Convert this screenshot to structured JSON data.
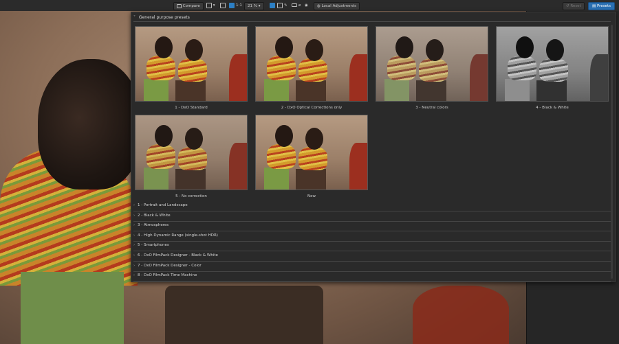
{
  "toolbar": {
    "compare_label": "Compare",
    "zoom_ratio": "1:1",
    "zoom_level": "21 %",
    "local_adjustments_label": "Local Adjustments",
    "reset_label": "Reset",
    "presets_label": "Presets"
  },
  "panel": {
    "header": "General purpose presets",
    "presets": [
      {
        "label": "1 - DxO Standard",
        "style": "normal"
      },
      {
        "label": "2 - DxO Optical Corrections only",
        "style": "normal"
      },
      {
        "label": "3 - Neutral colors",
        "style": "muted"
      },
      {
        "label": "4 - Black & White",
        "style": "bw"
      },
      {
        "label": "5 - No correction",
        "style": "flat"
      },
      {
        "label": "New",
        "style": "normal"
      }
    ],
    "categories": [
      "1 - Portrait and Landscape",
      "2 - Black & White",
      "3 - Atmospheres",
      "4 - High Dynamic Range (single-shot HDR)",
      "5 - Smartphones",
      "6 - DxO FilmPack Designer - Black & White",
      "7 - DxO FilmPack Designer - Color",
      "8 - DxO FilmPack Time Machine"
    ]
  },
  "colors": {
    "accent": "#2a6fb2",
    "panel_bg": "#2a2a2a"
  },
  "icons": [
    "compare-icon",
    "crop-icon",
    "move-icon",
    "eyedropper-icon",
    "repair-icon",
    "mask-icon",
    "eye-icon",
    "local-adjustments-icon",
    "chevron-down-icon",
    "chevron-right-icon"
  ]
}
